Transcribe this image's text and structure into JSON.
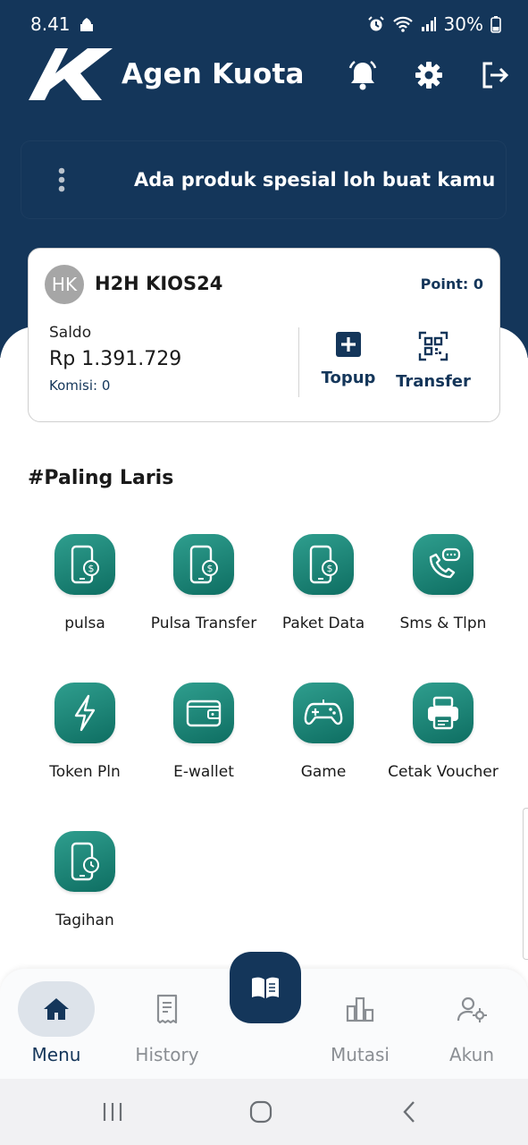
{
  "status_bar": {
    "time": "8.41",
    "battery": "30%"
  },
  "header": {
    "app_name": "Agen Kuota"
  },
  "promo": {
    "text": "Ada produk spesial loh buat kamu"
  },
  "account": {
    "initials": "HK",
    "name": "H2H KIOS24",
    "point": "Point: 0",
    "saldo_label": "Saldo",
    "saldo_value": "Rp 1.391.729",
    "komisi": "Komisi: 0",
    "topup_label": "Topup",
    "transfer_label": "Transfer"
  },
  "section": {
    "title": "#Paling Laris"
  },
  "products": [
    {
      "label": "pulsa",
      "icon": "phone-coin-icon"
    },
    {
      "label": "Pulsa Transfer",
      "icon": "phone-coin-icon"
    },
    {
      "label": "Paket Data",
      "icon": "phone-coin-icon"
    },
    {
      "label": "Sms & Tlpn",
      "icon": "phone-chat-icon"
    },
    {
      "label": "Token Pln",
      "icon": "lightning-icon"
    },
    {
      "label": "E-wallet",
      "icon": "wallet-icon"
    },
    {
      "label": "Game",
      "icon": "gamepad-icon"
    },
    {
      "label": "Cetak Voucher",
      "icon": "printer-icon"
    },
    {
      "label": "Tagihan",
      "icon": "phone-clock-icon"
    }
  ],
  "bottom_nav": {
    "menu": "Menu",
    "history": "History",
    "mutasi": "Mutasi",
    "akun": "Akun"
  },
  "colors": {
    "primary": "#14365a",
    "accent": "#1f8a7c"
  }
}
